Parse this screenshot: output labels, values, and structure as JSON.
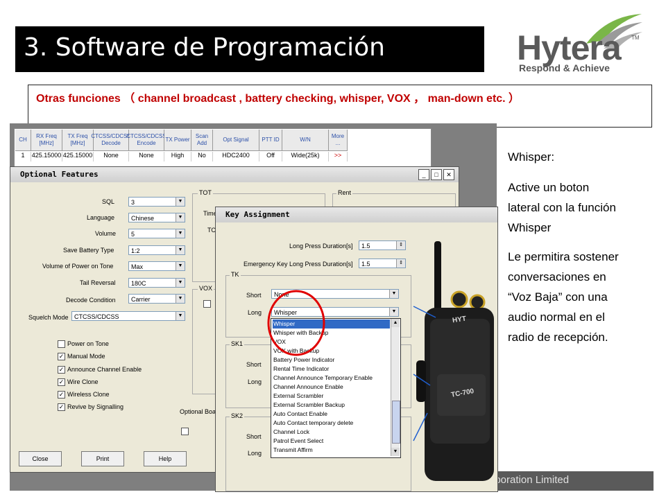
{
  "slide": {
    "title": "3. Software de Programación",
    "subtitle": "Otras funciones （ channel broadcast , battery checking, whisper, VOX ， man-down etc. ）",
    "logo_word": "Hytera",
    "logo_tagline": "Respond & Achieve",
    "logo_tm": "TM",
    "footer": "orporation Limited",
    "colors": {
      "title_bg": "#000000",
      "subtitle_text": "#c00000",
      "whisper_highlight": "#316ac5",
      "annotation_circle": "#e00000"
    }
  },
  "channel_table": {
    "headers": [
      "CH",
      "RX Freq [MHz]",
      "TX Freq [MHz]",
      "CTCSS/CDCSS Decode",
      "CTCSS/CDCSS Encode",
      "TX Power",
      "Scan Add",
      "Opt Signal",
      "PTT ID",
      "W/N",
      "More ..."
    ],
    "row": [
      "1",
      "425.15000",
      "425.15000",
      "None",
      "None",
      "High",
      "No",
      "HDC2400",
      "Off",
      "Wide(25k)",
      ">>"
    ]
  },
  "optional_features": {
    "title": "Optional Features",
    "fields": [
      {
        "label": "SQL",
        "value": "3"
      },
      {
        "label": "Language",
        "value": "Chinese"
      },
      {
        "label": "Volume",
        "value": "5"
      },
      {
        "label": "Save Battery Type",
        "value": "1:2"
      },
      {
        "label": "Volume of Power on Tone",
        "value": "Max"
      },
      {
        "label": "Tail Reversal",
        "value": "180C"
      },
      {
        "label": "Decode Condition",
        "value": "Carrier"
      }
    ],
    "squelch_label": "Squelch Mode",
    "squelch_value": "CTCSS/CDCSS",
    "checkboxes": [
      {
        "label": "Power on Tone",
        "checked": false
      },
      {
        "label": "Manual Mode",
        "checked": true
      },
      {
        "label": "Announce Channel Enable",
        "checked": true
      },
      {
        "label": "Wire Clone",
        "checked": true
      },
      {
        "label": "Wireless Clone",
        "checked": true
      },
      {
        "label": "Revive by Signalling",
        "checked": true
      }
    ],
    "groups": {
      "tot": "TOT",
      "rent": "Rent",
      "vox": "VOX",
      "optional_board": "Optional Boa"
    },
    "tot_partial": [
      "Time",
      "TO"
    ],
    "buttons": [
      "Close",
      "Print",
      "Help"
    ]
  },
  "key_assignment": {
    "title": "Key Assignment",
    "long_press_label": "Long Press Duration[s]",
    "long_press_value": "1.5",
    "emergency_label": "Emergency Key Long Press Duration[s]",
    "emergency_value": "1.5",
    "groups": [
      "TK",
      "SK1",
      "SK2"
    ],
    "short_label": "Short",
    "long_label": "Long",
    "tk_short": "None",
    "tk_long": "Whisper",
    "list_items": [
      "Whisper",
      "Whisper with Backup",
      "VOX",
      "VOX with Backup",
      "Battery Power Indicator",
      "Rental Time Indicator",
      "Channel Announce Temporary Enable",
      "Channel Announce  Enable",
      "External Scrambler",
      "External Scrambler Backup",
      "Auto Contact Enable",
      "Auto Contact temporary delete",
      "Channel Lock",
      "Patrol Event Select",
      "Transmit Affirm"
    ],
    "selected_index": 0
  },
  "radio": {
    "brand": "HYT",
    "model": "TC-700"
  },
  "right_text": {
    "heading": "Whisper:",
    "para1": [
      "Active un boton",
      "lateral con la función",
      "Whisper"
    ],
    "para2": [
      "Le permitira sostener",
      "conversaciones en",
      "“Voz Baja”  con una",
      "audio normal en el",
      "radio de recepción."
    ]
  }
}
